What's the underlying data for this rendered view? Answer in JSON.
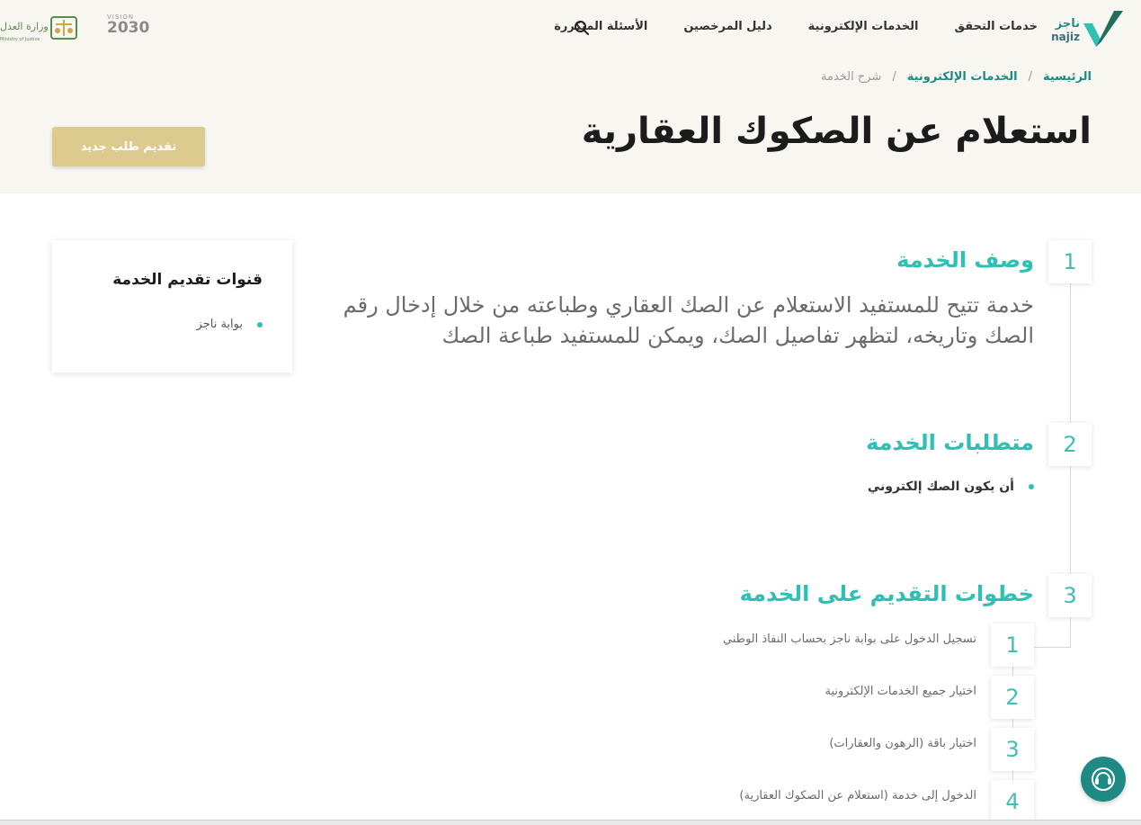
{
  "header": {
    "brand_name": "ناجز",
    "brand_latin": "najiz",
    "nav": [
      {
        "label": "خدمات التحقق"
      },
      {
        "label": "الخدمات الإلكترونية"
      },
      {
        "label": "دليل المرخصين"
      },
      {
        "label": "الأسئلة المتكررة"
      }
    ],
    "search_icon": "search-icon",
    "vision_label": "VISION",
    "vision_year": "2030",
    "moj_ar": "وزارة العدل",
    "moj_en": "Ministry of Justice"
  },
  "breadcrumb": {
    "home": "الرئيسية",
    "separator": "/",
    "eservices": "الخدمات الإلكترونية",
    "current": "شرح الخدمة"
  },
  "page": {
    "title": "استعلام عن الصكوك العقارية",
    "new_request_label": "تقديم طلب جديد"
  },
  "sections": {
    "description": {
      "number": "1",
      "title": "وصف الخدمة",
      "text": "خدمة تتيح للمستفيد الاستعلام عن الصك العقاري وطباعته من خلال إدخال رقم الصك وتاريخه، لتظهر تفاصيل الصك، ويمكن للمستفيد طباعة الصك"
    },
    "requirements": {
      "number": "2",
      "title": "متطلبات الخدمة",
      "items": [
        "أن يكون الصك إلكتروني"
      ]
    },
    "steps": {
      "number": "3",
      "title": "خطوات التقديم على الخدمة",
      "items": [
        {
          "number": "1",
          "text": "تسجيل الدخول على بوابة ناجز بحساب النفاذ الوطني"
        },
        {
          "number": "2",
          "text": "اختيار جميع الخدمات الإلكترونية"
        },
        {
          "number": "3",
          "text": "اختيار باقة (الرهون والعقارات)"
        },
        {
          "number": "4",
          "text": "الدخول إلى خدمة (استعلام عن الصكوك العقارية)"
        }
      ]
    }
  },
  "channels": {
    "title": "قنوات تقديم الخدمة",
    "items": [
      "بوابة ناجز"
    ]
  },
  "colors": {
    "accent": "#2ec0b2",
    "brand_dark": "#1f8a84",
    "gold": "#dcca8e",
    "hero_bg": "#f7f6f1"
  },
  "support_icon": "headset-support-icon"
}
